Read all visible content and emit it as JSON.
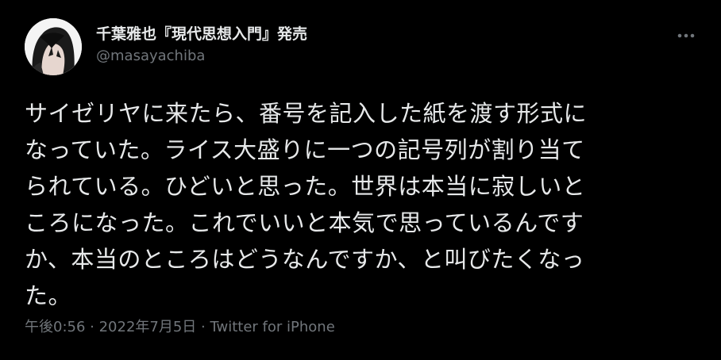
{
  "author": {
    "display_name": "千葉雅也『現代思想入門』発売",
    "handle": "@masayachiba",
    "avatar_icon": "profile-photo"
  },
  "menu": {
    "icon": "more-horizontal-icon"
  },
  "tweet": {
    "lines": [
      "サイゼリヤに来たら、番号を記入した紙を渡す形式に",
      "なっていた。ライス大盛りに一つの記号列が割り当て",
      "られている。ひどいと思った。世界は本当に寂しいと",
      "ころになった。これでいいと本気で思っているんです",
      "か、本当のところはどうなんですか、と叫びたくなっ",
      "た。"
    ]
  },
  "meta": {
    "time": "午後0:56",
    "separator1": " · ",
    "date": "2022年7月5日",
    "separator2": " · ",
    "source": "Twitter for iPhone"
  },
  "colors": {
    "background": "#000000",
    "primary_text": "#e7e9ea",
    "secondary_text": "#71767b"
  }
}
